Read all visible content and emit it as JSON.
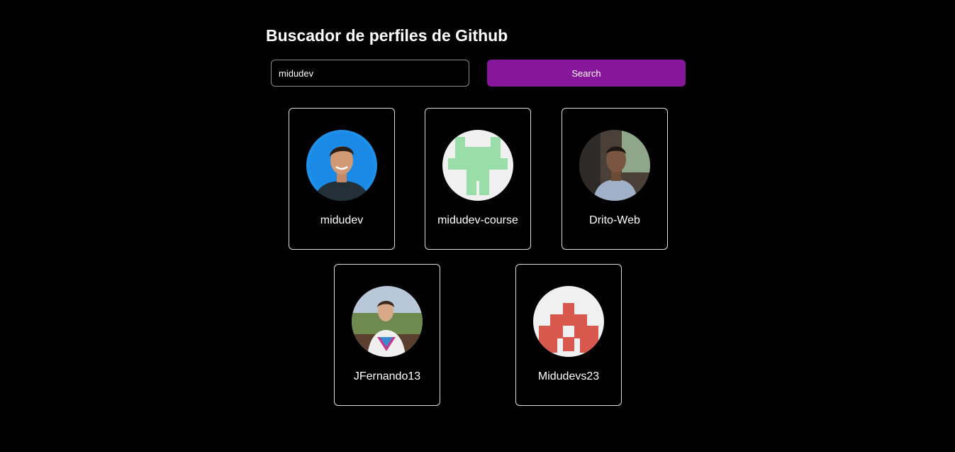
{
  "header": {
    "title": "Buscador de perfiles de Github"
  },
  "search": {
    "value": "midudev",
    "button_label": "Search"
  },
  "profiles": [
    {
      "username": "midudev",
      "avatar": "photo-person-blue-background"
    },
    {
      "username": "midudev-course",
      "avatar": "identicon-green"
    },
    {
      "username": "Drito-Web",
      "avatar": "photo-person-in-car"
    },
    {
      "username": "JFernando13",
      "avatar": "photo-person-outdoors"
    },
    {
      "username": "Midudevs23",
      "avatar": "identicon-red"
    }
  ],
  "colors": {
    "background": "#000000",
    "accent": "#86179a",
    "identicon_green": "#99dda8",
    "identicon_red": "#d9584d",
    "identicon_bg": "#f0f0f0"
  }
}
